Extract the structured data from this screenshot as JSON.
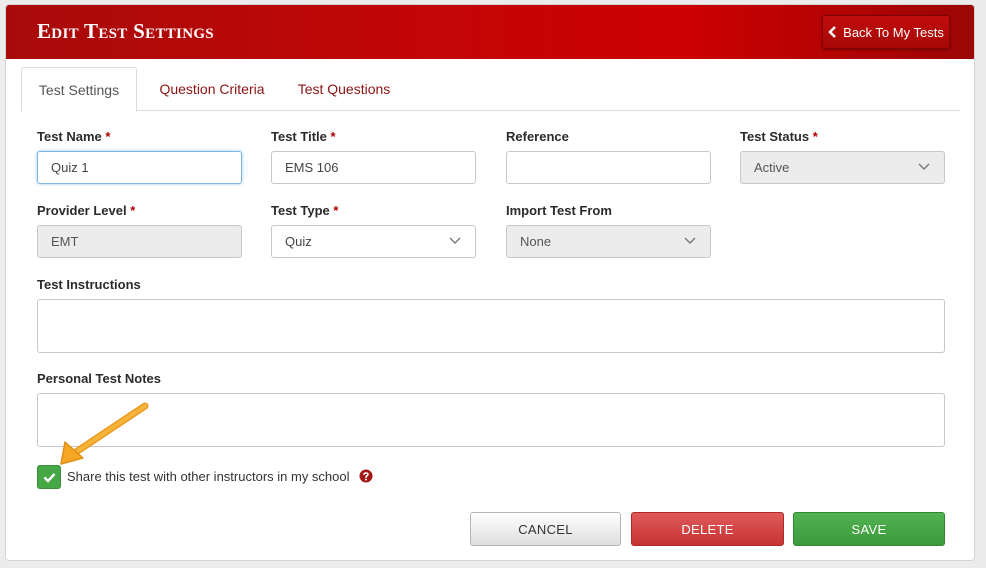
{
  "header": {
    "title": "Edit Test Settings",
    "back_button": "Back To My Tests"
  },
  "tabs": [
    {
      "label": "Test Settings",
      "active": true
    },
    {
      "label": "Question Criteria",
      "active": false
    },
    {
      "label": "Test Questions",
      "active": false
    }
  ],
  "form": {
    "test_name": {
      "label": "Test Name",
      "value": "Quiz 1"
    },
    "test_title": {
      "label": "Test Title",
      "value": "EMS 106"
    },
    "reference": {
      "label": "Reference",
      "value": ""
    },
    "test_status": {
      "label": "Test Status",
      "value": "Active"
    },
    "provider_level": {
      "label": "Provider Level",
      "value": "EMT"
    },
    "test_type": {
      "label": "Test Type",
      "value": "Quiz"
    },
    "import_test_from": {
      "label": "Import Test From",
      "value": "None"
    },
    "test_instructions": {
      "label": "Test Instructions",
      "value": ""
    },
    "personal_test_notes": {
      "label": "Personal Test Notes",
      "value": ""
    },
    "required_marker": "*"
  },
  "share": {
    "label": "Share this test with other instructors in my school",
    "checked": true
  },
  "buttons": {
    "cancel": "CANCEL",
    "delete": "DELETE",
    "save": "SAVE"
  },
  "colors": {
    "brand_red": "#c40606",
    "save_green": "#45a845",
    "delete_red": "#d04444",
    "tab_link": "#8b1414",
    "annotation_arrow": "#f5a623"
  },
  "icons": {
    "back": "chevron-left-icon",
    "select": "chevron-down-icon",
    "check": "checkmark-icon",
    "help": "question-circle-icon",
    "annotation": "arrow-icon"
  }
}
